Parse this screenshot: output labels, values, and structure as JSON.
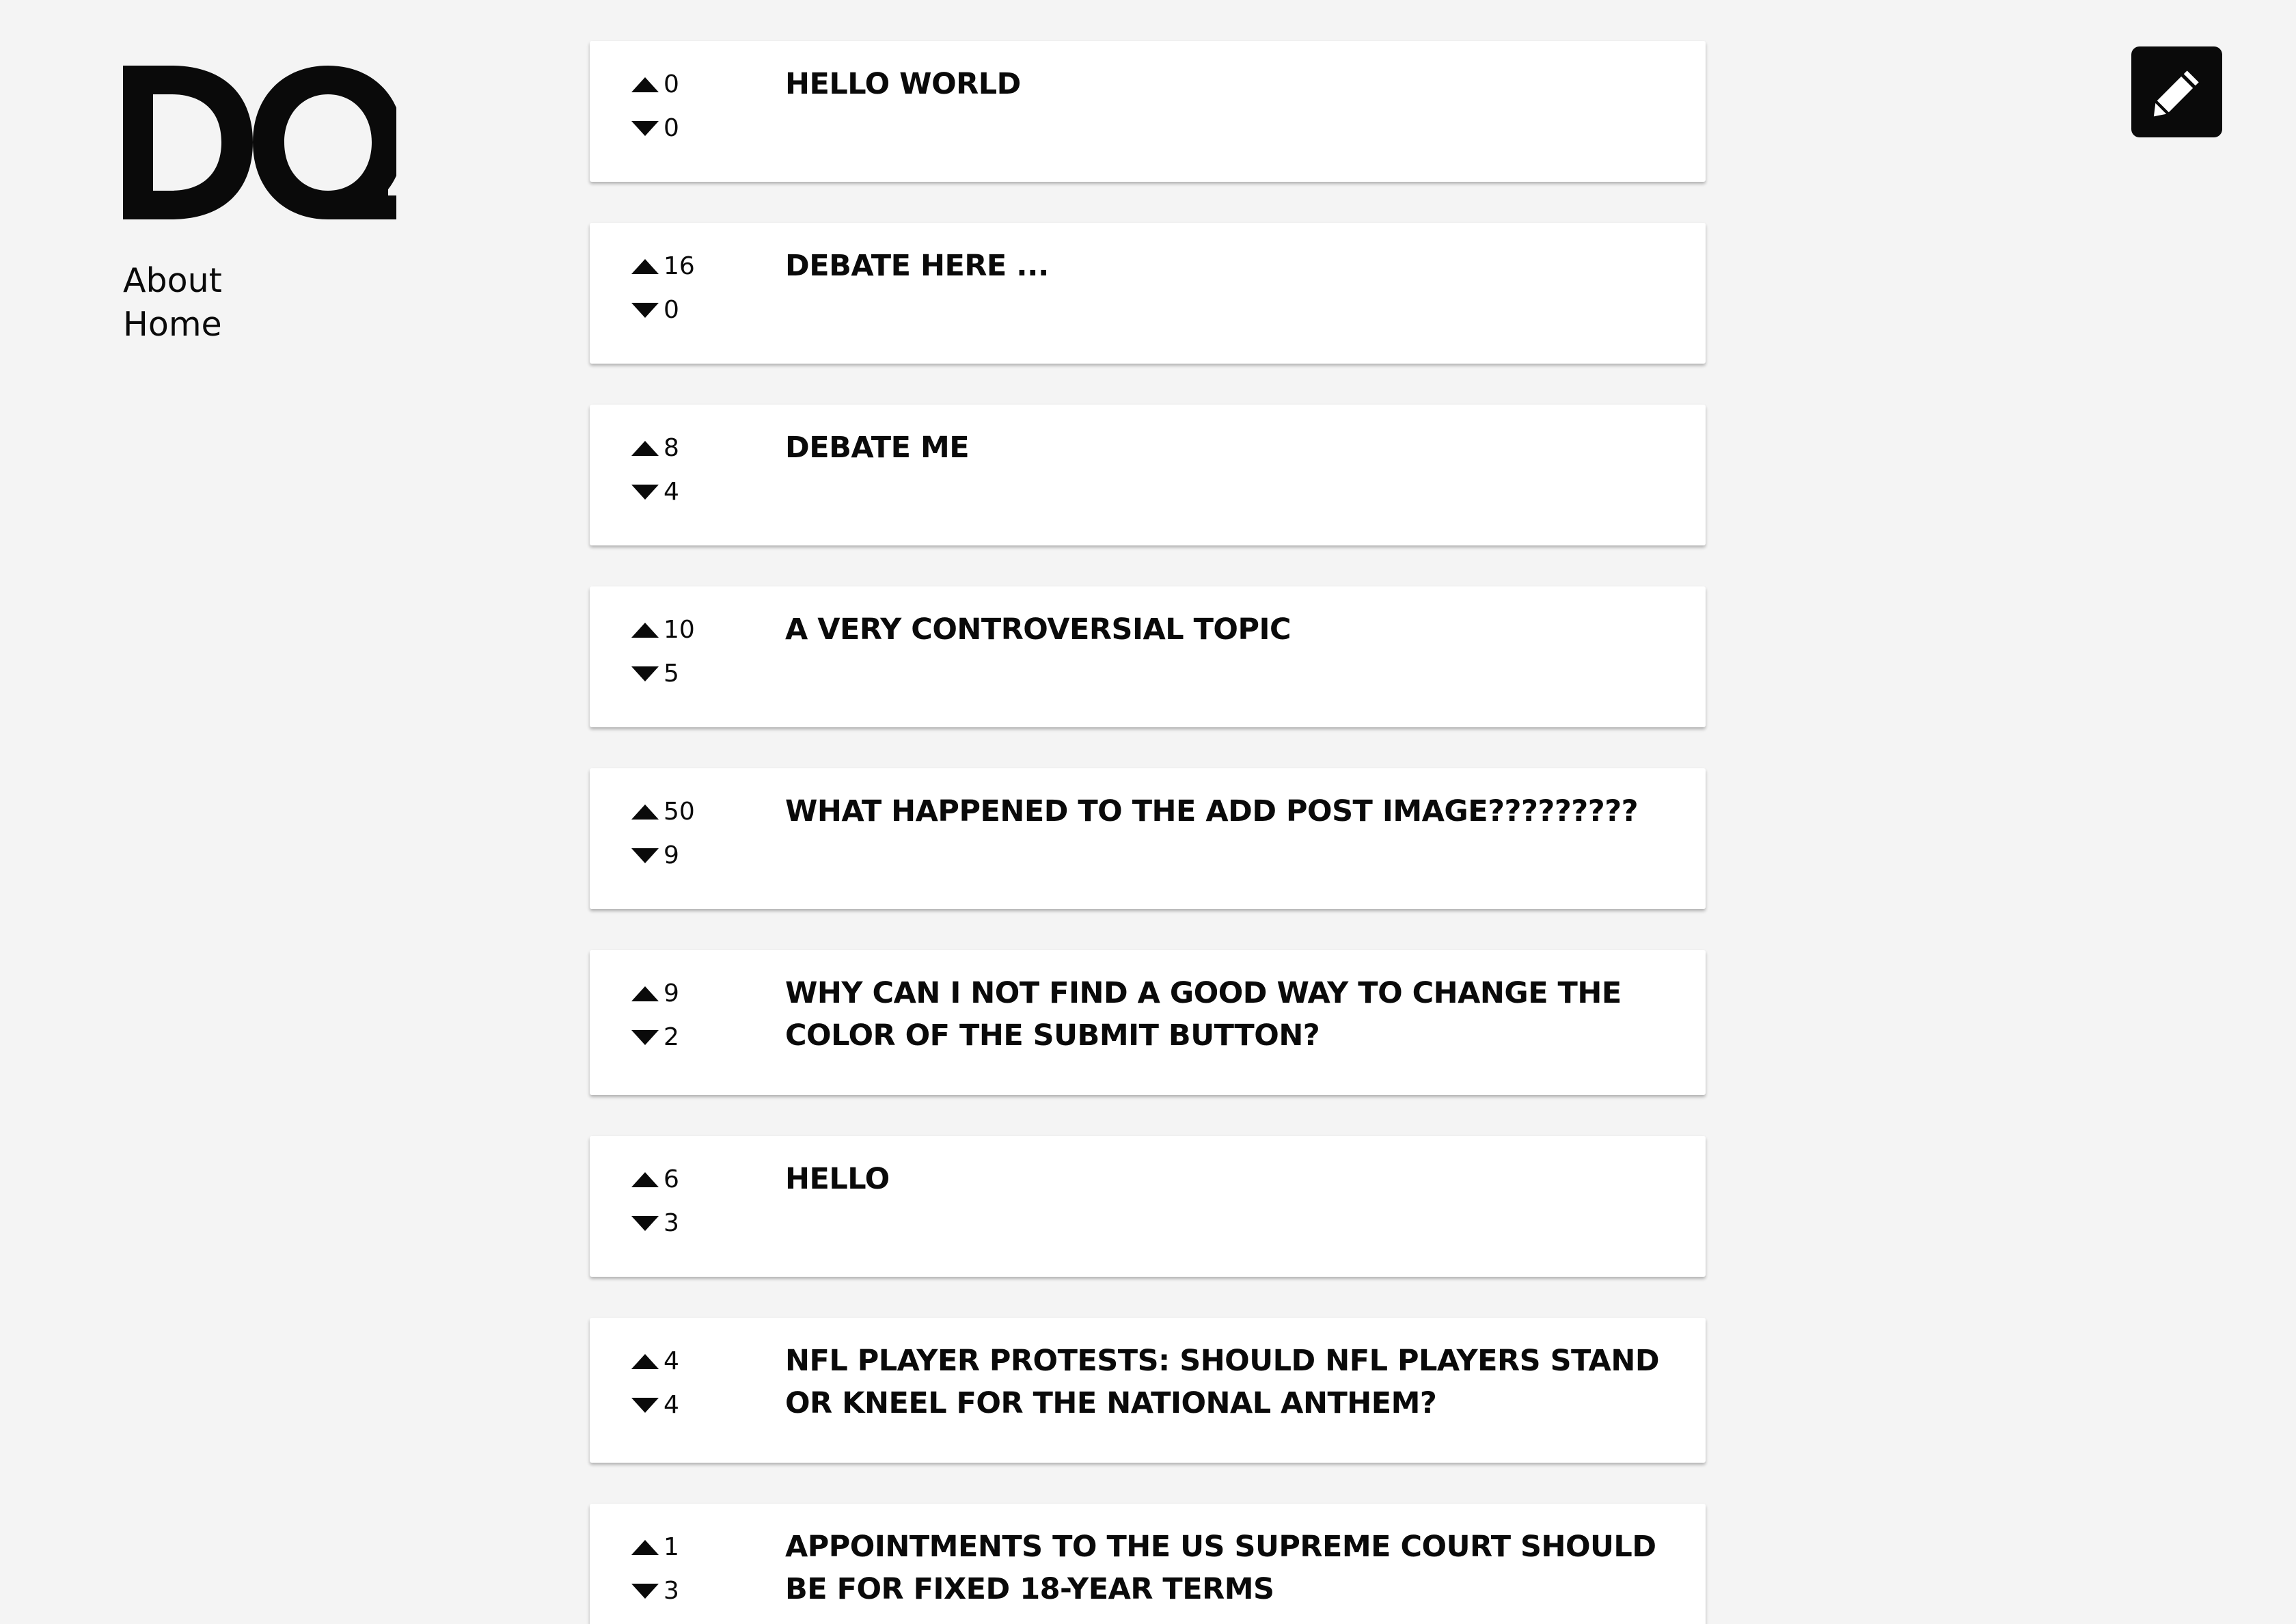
{
  "brand": {
    "logo_text": "DQ"
  },
  "nav": {
    "about_label": "About",
    "home_label": "Home"
  },
  "toolbar": {
    "edit_icon": "pencil-icon"
  },
  "icons": {
    "upvote": "triangle-up-icon",
    "downvote": "triangle-down-icon"
  },
  "posts": [
    {
      "title": "HELLO WORLD",
      "up": "0",
      "down": "0"
    },
    {
      "title": "DEBATE HERE ...",
      "up": "16",
      "down": "0"
    },
    {
      "title": "DEBATE ME",
      "up": "8",
      "down": "4"
    },
    {
      "title": "A VERY CONTROVERSIAL TOPIC",
      "up": "10",
      "down": "5"
    },
    {
      "title": "WHAT HAPPENED TO THE ADD POST IMAGE?????????",
      "up": "50",
      "down": "9"
    },
    {
      "title": "WHY CAN I NOT FIND A GOOD WAY TO CHANGE THE COLOR OF THE SUBMIT BUTTON?",
      "up": "9",
      "down": "2"
    },
    {
      "title": "HELLO",
      "up": "6",
      "down": "3"
    },
    {
      "title": "NFL PLAYER PROTESTS: SHOULD NFL PLAYERS STAND OR KNEEL FOR THE NATIONAL ANTHEM?",
      "up": "4",
      "down": "4"
    },
    {
      "title": "APPOINTMENTS TO THE US SUPREME COURT SHOULD BE FOR FIXED 18-YEAR TERMS",
      "up": "1",
      "down": "3"
    }
  ]
}
